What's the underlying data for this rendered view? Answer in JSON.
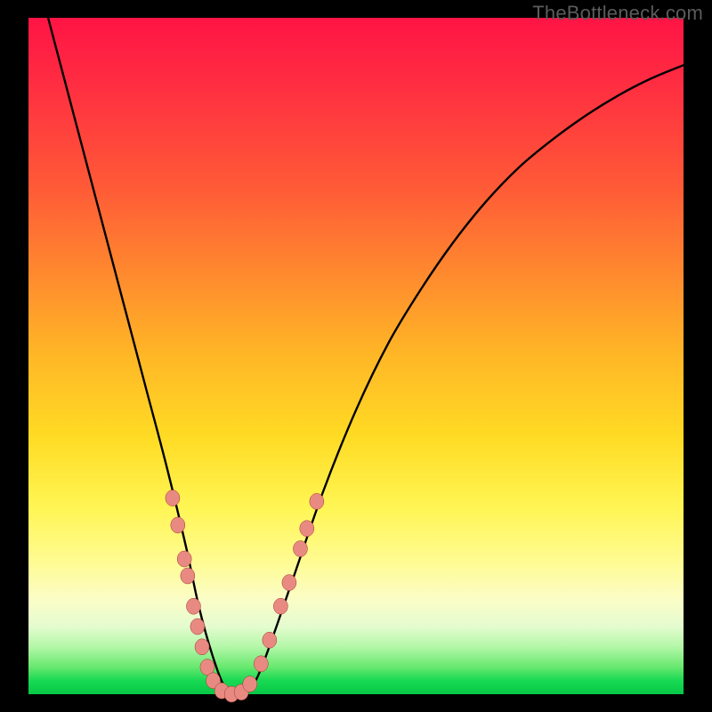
{
  "watermark": "TheBottleneck.com",
  "colors": {
    "curve": "#000000",
    "marker_fill": "#e88a82",
    "marker_stroke": "#a0362f",
    "frame": "#000000"
  },
  "chart_data": {
    "type": "line",
    "title": "",
    "xlabel": "",
    "ylabel": "",
    "xlim": [
      0,
      100
    ],
    "ylim": [
      0,
      100
    ],
    "note": "V-shaped bottleneck curve on a red-to-green vertical gradient. Curve is a single black line; pink dots cluster near the minimum. No axis ticks or numeric labels are visible.",
    "series": [
      {
        "name": "curve",
        "x": [
          3,
          6,
          9,
          12,
          15,
          18,
          21,
          24,
          26,
          28,
          30,
          32,
          34,
          36,
          40,
          45,
          50,
          55,
          60,
          65,
          70,
          75,
          80,
          85,
          90,
          95,
          100
        ],
        "y": [
          100,
          89,
          78,
          67,
          56,
          45,
          34,
          22,
          13,
          6,
          1,
          0,
          1,
          5,
          16,
          30,
          42,
          52,
          60,
          67,
          73,
          78,
          82,
          85.5,
          88.5,
          91,
          93
        ]
      }
    ],
    "markers": [
      {
        "x": 22.0,
        "y": 29.0
      },
      {
        "x": 22.8,
        "y": 25.0
      },
      {
        "x": 23.8,
        "y": 20.0
      },
      {
        "x": 24.3,
        "y": 17.5
      },
      {
        "x": 25.2,
        "y": 13.0
      },
      {
        "x": 25.8,
        "y": 10.0
      },
      {
        "x": 26.5,
        "y": 7.0
      },
      {
        "x": 27.3,
        "y": 4.0
      },
      {
        "x": 28.2,
        "y": 2.0
      },
      {
        "x": 29.5,
        "y": 0.5
      },
      {
        "x": 31.0,
        "y": 0.0
      },
      {
        "x": 32.5,
        "y": 0.3
      },
      {
        "x": 33.8,
        "y": 1.5
      },
      {
        "x": 35.5,
        "y": 4.5
      },
      {
        "x": 36.8,
        "y": 8.0
      },
      {
        "x": 38.5,
        "y": 13.0
      },
      {
        "x": 39.8,
        "y": 16.5
      },
      {
        "x": 41.5,
        "y": 21.5
      },
      {
        "x": 42.5,
        "y": 24.5
      },
      {
        "x": 44.0,
        "y": 28.5
      }
    ]
  }
}
